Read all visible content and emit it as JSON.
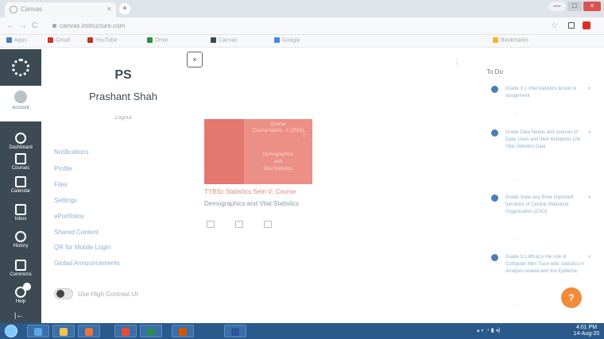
{
  "browser": {
    "tab_title": "Canvas",
    "tab_close": "×",
    "new_tab": "+",
    "url": "canvas.instructure.com",
    "nav": {
      "back": "←",
      "forward": "→",
      "reload": "C"
    },
    "star": "☆",
    "window_controls": {
      "minimize": "—",
      "maximize": "□",
      "close": "×"
    },
    "bookmarks": [
      {
        "label": "Apps",
        "icon": "apps-icon",
        "color": "#4a7fb5"
      },
      {
        "label": "Gmail",
        "icon": "gmail-icon",
        "color": "#d93025"
      },
      {
        "label": "YouTube",
        "icon": "youtube-icon",
        "color": "#c4302b"
      },
      {
        "label": "Drive",
        "icon": "drive-icon",
        "color": "#2f8f46"
      },
      {
        "label": "Canvas",
        "icon": "canvas-icon",
        "color": "#3c4a54"
      },
      {
        "label": "Google",
        "icon": "google-icon",
        "color": "#4285f4"
      },
      {
        "label": "Bookmarks",
        "icon": "folder-icon",
        "color": "#f2b73a"
      }
    ]
  },
  "global_nav": {
    "account": "Account",
    "items": [
      {
        "label": "Dashboard",
        "icon": "dashboard-icon"
      },
      {
        "label": "Courses",
        "icon": "courses-icon"
      },
      {
        "label": "Calendar",
        "icon": "calendar-icon"
      },
      {
        "label": "Inbox",
        "icon": "inbox-icon"
      },
      {
        "label": "History",
        "icon": "history-icon"
      },
      {
        "label": "Commons",
        "icon": "commons-icon"
      },
      {
        "label": "Help",
        "icon": "help-icon",
        "badge": "1"
      }
    ],
    "collapse": "|←"
  },
  "profile": {
    "initials": "PS",
    "name": "Prashant Shah",
    "logout": "Logout",
    "close": "×",
    "links": [
      "Notifications",
      "Profile",
      "Files",
      "Settings",
      "ePortfolios",
      "Shared Content",
      "QR for Mobile Login",
      "Global Announcements"
    ],
    "toggle_label": "Use High Contrast UI"
  },
  "course_card": {
    "head_lines": [
      "Quarter",
      "Course Name - 1 (2019)",
      "Demographics",
      "and",
      "Vital Statistics"
    ],
    "title": "TYBSc Statistics Sem V: Course",
    "subtitle": "Demographics and Vital Statistics",
    "accent": "#ec8f87",
    "icons": [
      "announcements-icon",
      "assignments-icon",
      "discussions-icon"
    ]
  },
  "todo": {
    "title": "To Do",
    "items": [
      {
        "text": "Grade 3.1 Vital statistics lesson & assignment",
        "meta": "—"
      },
      {
        "text": "Grade Data Needs and sources of Data: Uses and their limitations Life Vital statistics Data",
        "meta": "—"
      },
      {
        "text": "Grade State any three important functions of Central Statistical Organisation (CSO)",
        "meta": "—"
      },
      {
        "text": "Grade 3.1 What is the role of Computer Mini Track with statistics in Analysis related with the Epidemic",
        "meta": "—"
      }
    ],
    "dismiss": "×"
  },
  "help_button": "?",
  "taskbar": {
    "apps": [
      {
        "icon": "ie-icon",
        "color": "#5aa9e6"
      },
      {
        "icon": "folder-icon",
        "color": "#f2c14e"
      },
      {
        "icon": "media-icon",
        "color": "#e8753a"
      },
      {
        "icon": "chrome-icon",
        "color": "#e74c3c"
      },
      {
        "icon": "excel-icon",
        "color": "#2e8b57"
      },
      {
        "icon": "powerpoint-icon",
        "color": "#d35400"
      },
      {
        "icon": "word-icon",
        "color": "#2b579a"
      }
    ],
    "time": "4:01 PM",
    "date": "14-Aug-20"
  }
}
